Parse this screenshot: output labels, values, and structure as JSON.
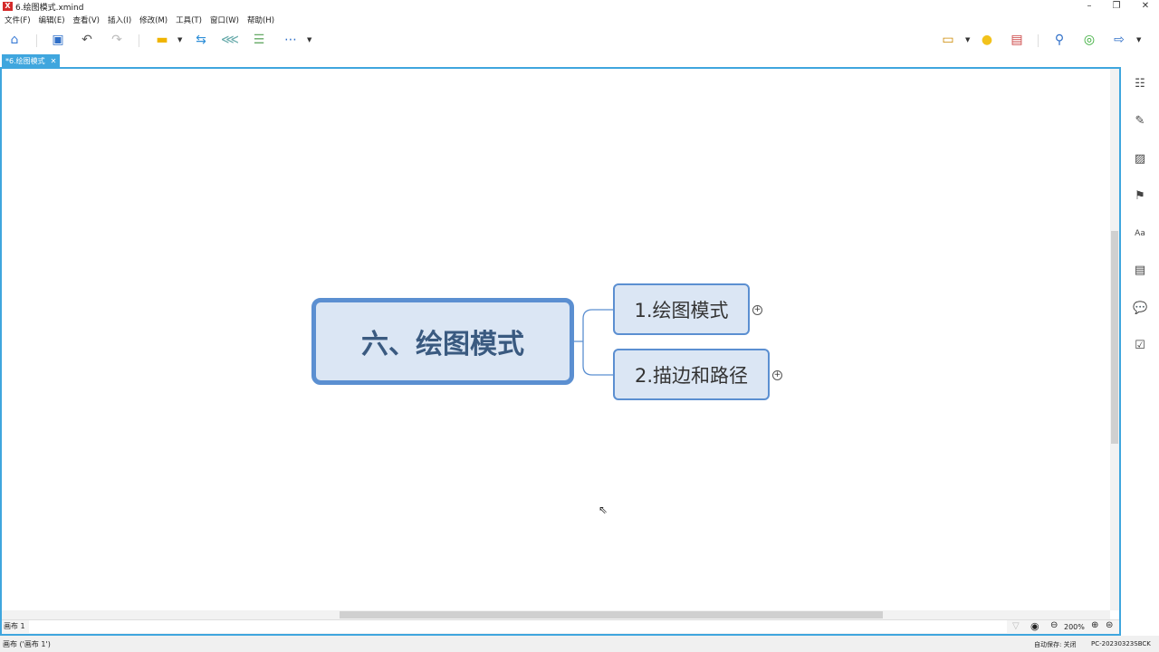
{
  "window": {
    "title": "6.绘图模式.xmind",
    "logo": "X"
  },
  "menu": [
    "文件(F)",
    "编辑(E)",
    "查看(V)",
    "插入(I)",
    "修改(M)",
    "工具(T)",
    "窗口(W)",
    "帮助(H)"
  ],
  "tab": {
    "label": "*6.绘图模式",
    "close": "✕"
  },
  "mindmap": {
    "central": "六、绘图模式",
    "subtopics": [
      "1.绘图模式",
      "2.描边和路径"
    ]
  },
  "sheet": {
    "label": "画布 1"
  },
  "zoom": {
    "level": "200%"
  },
  "status": {
    "left": "画布 ('画布 1')",
    "autosave": "自动保存: 关闭",
    "computer": "PC-20230323SBCK"
  },
  "colors": {
    "accent": "#3fa6de",
    "topic_border": "#5b8fd1",
    "topic_fill": "#dbe6f4"
  }
}
